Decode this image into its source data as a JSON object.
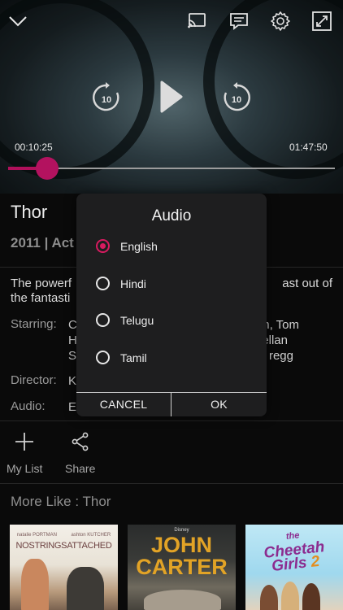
{
  "player": {
    "elapsed": "00:10:25",
    "duration": "01:47:50",
    "progress": 0.12,
    "rewind_seconds": "10",
    "forward_seconds": "10",
    "accent_color": "#b3125f"
  },
  "details": {
    "title": "Thor",
    "meta_partial": "2011 | Act",
    "description_line1_left": "The powerf",
    "description_line1_right": "ast out of",
    "description_line2_left": "the fantasti",
    "starring_label": "Starring:",
    "starring_col1": [
      "C",
      "H",
      "S"
    ],
    "starring_right": [
      "n, Tom",
      "ellan",
      "regg"
    ],
    "director_label": "Director:",
    "director_partial": "K",
    "audio_label": "Audio:",
    "audio_partial": "E"
  },
  "actions": {
    "my_list_label": "My List",
    "share_label": "Share"
  },
  "more_like": {
    "heading": "More Like : Thor",
    "posters": [
      {
        "name": "no-strings-attached",
        "top_text_a": "natalie PORTMAN",
        "top_text_b": "ashton KUTCHER",
        "title": "NOSTRINGSATTACHED"
      },
      {
        "name": "john-carter",
        "studio": "Disney",
        "title_line1": "JOHN",
        "title_line2": "CARTER"
      },
      {
        "name": "the-cheetah-girls-2",
        "title_line1": "the",
        "title_line2": "Cheetah",
        "title_line3": "Girls",
        "number": "2"
      }
    ]
  },
  "audio_dialog": {
    "title": "Audio",
    "options": [
      "English",
      "Hindi",
      "Telugu",
      "Tamil"
    ],
    "selected_index": 0,
    "cancel_label": "CANCEL",
    "ok_label": "OK",
    "accent_color": "#d81b60"
  }
}
